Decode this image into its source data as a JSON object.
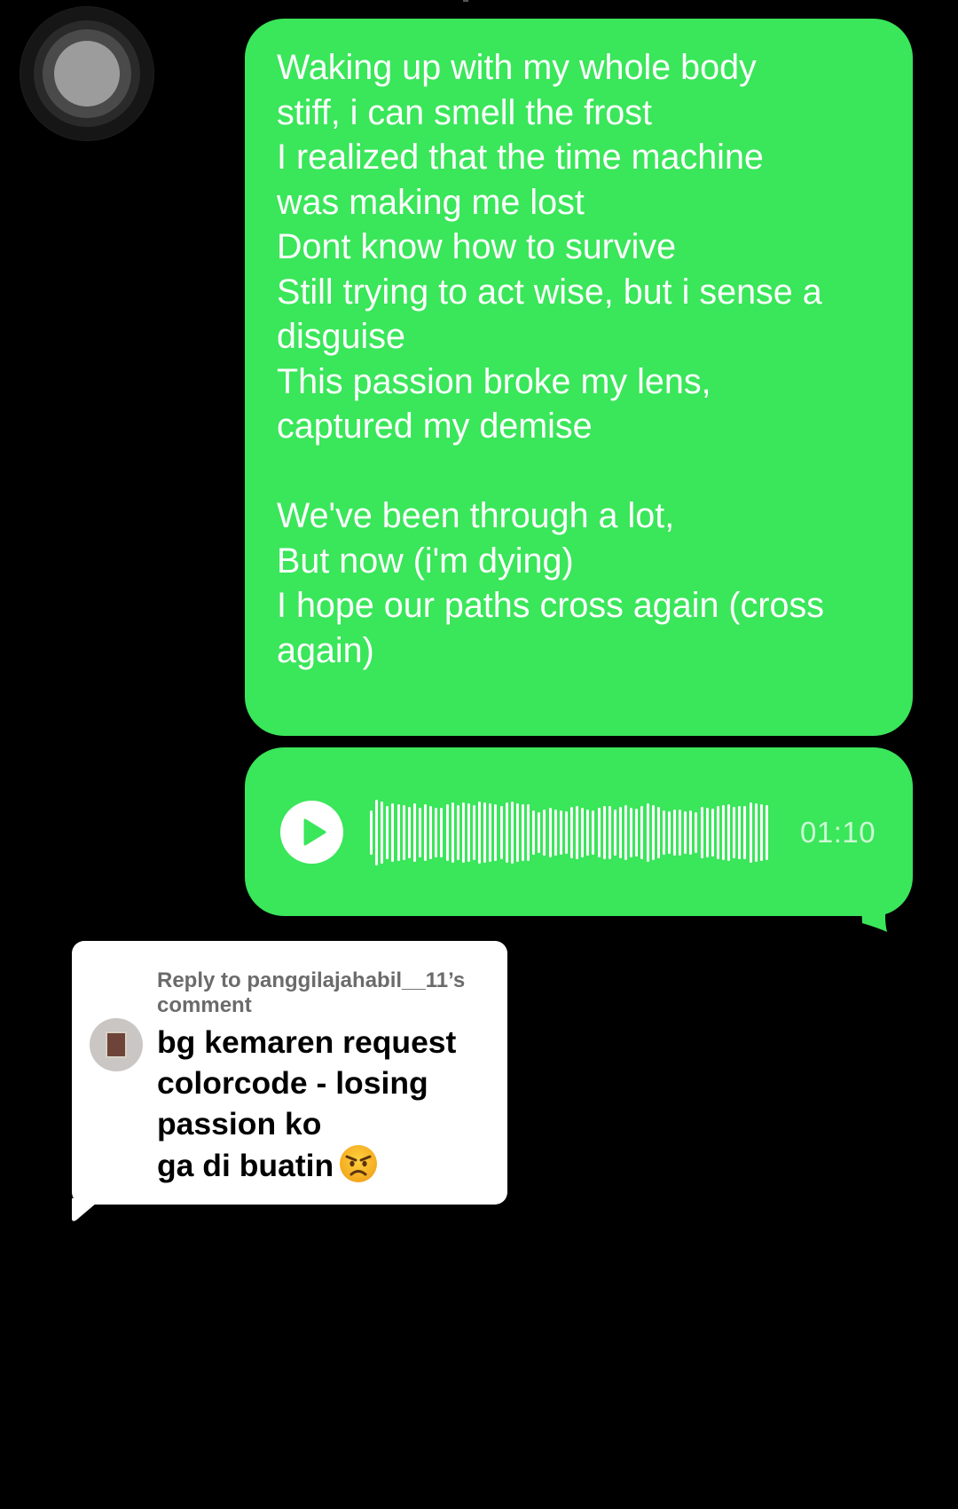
{
  "lyrics_message": {
    "text": "Waking up with my whole body\nstiff, i can smell the frost\nI realized that the time machine\nwas making me lost\nDont know how to survive\nStill trying to act wise, but i sense a\ndisguise\nThis passion broke my lens,\ncaptured my demise\n\nWe've been through a lot,\nBut now (i'm dying)\nI hope our paths cross again (cross\nagain)"
  },
  "voice_message": {
    "duration": "01:10",
    "play_icon": "play-icon",
    "waveform_levels": [
      0.62,
      0.92,
      0.88,
      0.74,
      0.83,
      0.8,
      0.78,
      0.72,
      0.82,
      0.7,
      0.79,
      0.75,
      0.71,
      0.69,
      0.8,
      0.84,
      0.77,
      0.86,
      0.83,
      0.78,
      0.88,
      0.85,
      0.82,
      0.8,
      0.76,
      0.84,
      0.87,
      0.83,
      0.8,
      0.79,
      0.62,
      0.58,
      0.66,
      0.7,
      0.64,
      0.62,
      0.6,
      0.72,
      0.74,
      0.7,
      0.64,
      0.62,
      0.7,
      0.76,
      0.74,
      0.66,
      0.72,
      0.78,
      0.7,
      0.68,
      0.74,
      0.82,
      0.78,
      0.72,
      0.62,
      0.6,
      0.64,
      0.66,
      0.6,
      0.62,
      0.58,
      0.72,
      0.7,
      0.68,
      0.74,
      0.78,
      0.8,
      0.72,
      0.74,
      0.76,
      0.86,
      0.82,
      0.8,
      0.78
    ]
  },
  "reply_card": {
    "header": "Reply to panggilajahabil__11’s comment",
    "comment": "bg kemaren request\ncolorcode - losing\npassion ko\nga di buatin",
    "emoji": "angry-face-emoji"
  },
  "colors": {
    "bubble_green": "#3ae65a",
    "background": "#000000"
  }
}
